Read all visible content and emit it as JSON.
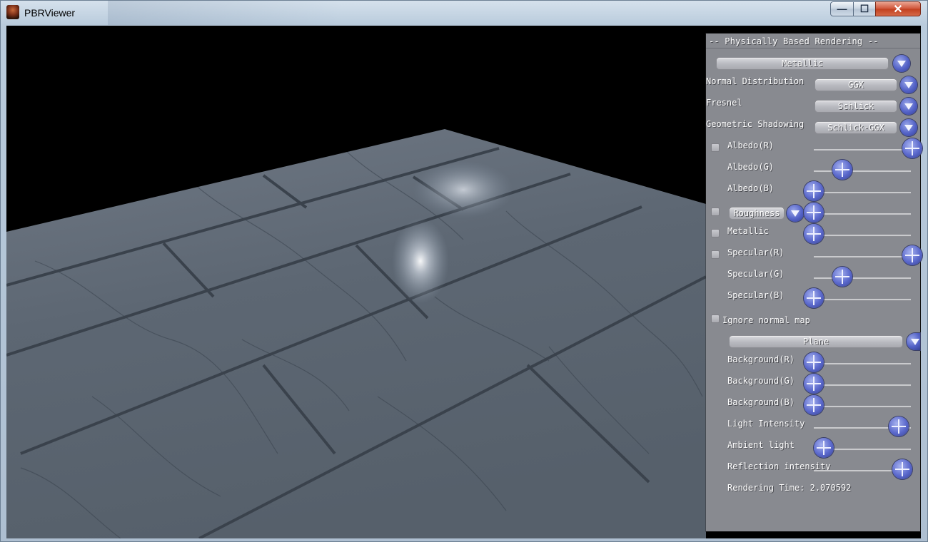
{
  "window": {
    "title": "PBRViewer",
    "minimize_glyph": "—",
    "maximize_glyph": "☐",
    "close_glyph": "✕"
  },
  "panel": {
    "title": "-- Physically Based Rendering --",
    "workflow": {
      "value": "Metallic"
    },
    "normal_distribution": {
      "label": "Normal Distribution",
      "value": "GGX"
    },
    "fresnel": {
      "label": "Fresnel",
      "value": "Schlick"
    },
    "geometric_shadowing": {
      "label": "Geometric Shadowing",
      "value": "Schlick-GGX"
    },
    "albedo_r": {
      "label": "Albedo(R)",
      "value": 1.0,
      "checked": false
    },
    "albedo_g": {
      "label": "Albedo(G)",
      "value": 0.29
    },
    "albedo_b": {
      "label": "Albedo(B)",
      "value": 0.0
    },
    "roughness": {
      "label": "Roughness",
      "value": 0.0,
      "checked": false
    },
    "metallic": {
      "label": "Metallic",
      "value": 0.0,
      "checked": false
    },
    "specular_r": {
      "label": "Specular(R)",
      "value": 1.0,
      "checked": false
    },
    "specular_g": {
      "label": "Specular(G)",
      "value": 0.29
    },
    "specular_b": {
      "label": "Specular(B)",
      "value": 0.0
    },
    "ignore_normal_map": {
      "label": "Ignore normal map",
      "checked": false
    },
    "mesh": {
      "value": "Plane"
    },
    "background_r": {
      "label": "Background(R)",
      "value": 0.0
    },
    "background_g": {
      "label": "Background(G)",
      "value": 0.0
    },
    "background_b": {
      "label": "Background(B)",
      "value": 0.0
    },
    "light_intensity": {
      "label": "Light Intensity",
      "value": 0.86
    },
    "ambient_light": {
      "label": "Ambient light",
      "value": 0.1
    },
    "reflection_intensity": {
      "label": "Reflection intensity",
      "value": 0.9
    },
    "rendering_time": "Rendering Time: 2.070592"
  },
  "colors": {
    "viewport_bg": "#000000",
    "panel_bg": "#94969c",
    "knob_blue": "#5a68cc",
    "marble_base": "#5b6673"
  }
}
